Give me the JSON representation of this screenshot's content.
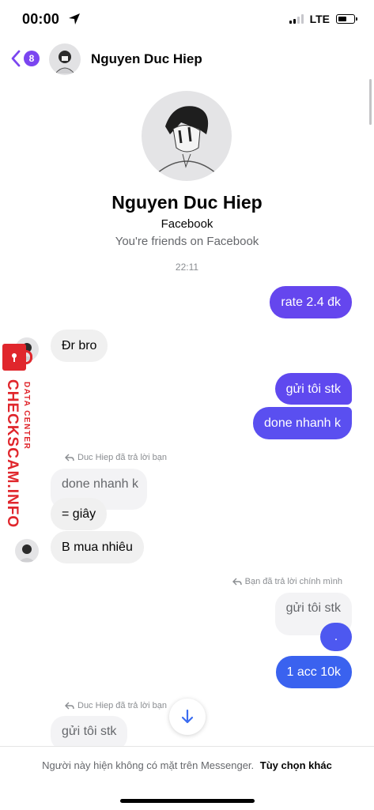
{
  "status_bar": {
    "time": "00:00",
    "network": "LTE",
    "battery_level": 0.6
  },
  "header": {
    "unread_count": "8",
    "contact_name": "Nguyen Duc Hiep"
  },
  "profile": {
    "name": "Nguyen Duc Hiep",
    "platform": "Facebook",
    "friend_status": "You're friends on Facebook",
    "timestamp": "22:11"
  },
  "messages": {
    "m1_out": "rate 2.4 đk",
    "m2_in": "Đr bro",
    "m3_out": "gửi tôi stk",
    "m4_out": "done nhanh k",
    "reply_note_1": "Duc Hiep đã trả lời bạn",
    "m5_quoted": "done nhanh k",
    "m5_in": "= giây",
    "m6_in": "B mua nhiêu",
    "reply_note_2": "Bạn đã trả lời chính mình",
    "m7_quoted": "gửi tôi stk",
    "m7_out": ".",
    "m8_out": "1 acc 10k",
    "reply_note_3": "Duc Hiep đã trả lời bạn",
    "m9_quoted": "gửi tôi stk"
  },
  "watermark": {
    "brand": "CHECKSCAM.INFO",
    "tagline": "DATA CENTER"
  },
  "footer": {
    "notice": "Người này hiện không có mặt trên Messenger.",
    "more_options": "Tùy chọn khác"
  },
  "colors": {
    "accent_purple": "#7b45f0",
    "bubble_purple": "#6546ee",
    "bubble_mid": "#5a4ff0",
    "bubble_blue": "#3a62ef",
    "watermark_red": "#e0262c"
  },
  "icons": [
    "location-arrow-icon",
    "signal-icon",
    "battery-icon",
    "back-chevron-icon",
    "reply-arrow-icon",
    "scroll-down-arrow-icon",
    "lock-icon"
  ]
}
